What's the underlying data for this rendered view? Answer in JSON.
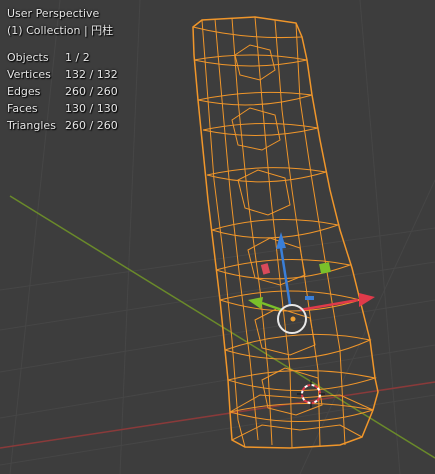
{
  "viewport": {
    "view_name": "User Perspective",
    "collection_line": "(1) Collection | 円柱",
    "background": "#3d3d3d",
    "wire_color": "#f0962a",
    "grid_color": "#4a4a4a",
    "x_axis_color": "#8a3a3a",
    "y_axis_color": "#6a8a2a"
  },
  "stats": [
    {
      "label": "Objects",
      "value": "1 / 2"
    },
    {
      "label": "Vertices",
      "value": "132 / 132"
    },
    {
      "label": "Edges",
      "value": "260 / 260"
    },
    {
      "label": "Faces",
      "value": "130 / 130"
    },
    {
      "label": "Triangles",
      "value": "260 / 260"
    }
  ],
  "gizmo": {
    "z_arrow_color": "#3a7fd9",
    "x_arrow_color": "#e03a4a",
    "y_arrow_color": "#7ac02a",
    "ring_color": "#e8e8e8",
    "origin_color": "#f0a030"
  },
  "cursor_3d": {
    "icon": "3d-cursor-icon"
  }
}
